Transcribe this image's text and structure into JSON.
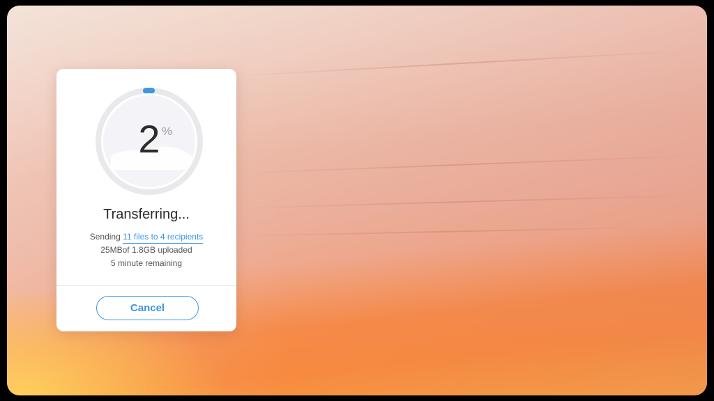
{
  "dialog": {
    "progress": {
      "value": "2",
      "unit": "%",
      "fraction": 0.02
    },
    "title": "Transferring...",
    "sending_prefix": "Sending",
    "sending_link": "11 files to 4 recipients",
    "uploaded": "25MBof 1.8GB uploaded",
    "remaining": "5 minute remaining",
    "cancel_label": "Cancel"
  },
  "colors": {
    "accent": "#3b97e3",
    "ring_track": "#e9e9eb",
    "ring_inner": "#f4f4f8"
  },
  "icons": {
    "ring": "circular-progress-ring"
  }
}
